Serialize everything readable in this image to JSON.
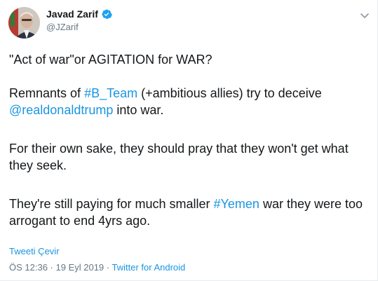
{
  "author": {
    "display_name": "Javad Zarif",
    "handle": "@JZarif",
    "verified": true
  },
  "tweet": {
    "line1": "\"Act of war\"or AGITATION for WAR?",
    "p2_a": "Remnants of ",
    "p2_hashtag": "#B_Team",
    "p2_b": " (+ambitious allies) try to deceive ",
    "p2_mention": "@realdonaldtrump",
    "p2_c": " into war.",
    "p3": "For their own sake, they should pray that they won't get what they seek.",
    "p4_a": "They're still paying for much smaller ",
    "p4_hashtag": "#Yemen",
    "p4_b": " war they were too arrogant to end 4yrs ago."
  },
  "translate_label": "Tweeti Çevir",
  "meta": {
    "time": "ÖS 12:36",
    "sep1": " · ",
    "date": "19 Eyl 2019",
    "sep2": " · ",
    "source": "Twitter for Android"
  },
  "colors": {
    "link": "#1b95e0",
    "text": "#14171a",
    "muted": "#657786",
    "verified": "#1da1f2"
  },
  "icons": {
    "verified": "verified-badge-icon",
    "caret": "chevron-down-icon"
  }
}
